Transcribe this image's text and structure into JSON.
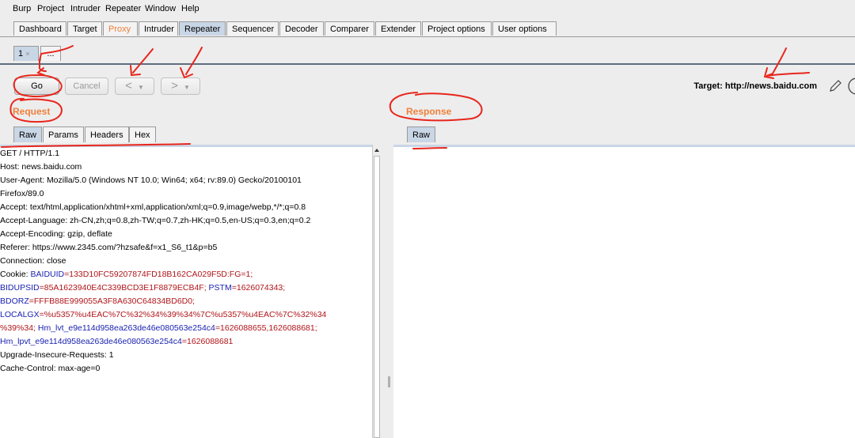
{
  "menu": [
    "Burp",
    "Project",
    "Intruder",
    "Repeater",
    "Window",
    "Help"
  ],
  "tool_tabs": [
    "Dashboard",
    "Target",
    "Proxy",
    "Intruder",
    "Repeater",
    "Sequencer",
    "Decoder",
    "Comparer",
    "Extender",
    "Project options",
    "User options"
  ],
  "repeater_tabs": {
    "tab1": "1",
    "tab1_close": "×",
    "more": "..."
  },
  "toolbar": {
    "go": "Go",
    "cancel": "Cancel",
    "back": "<",
    "back_dd": "▼",
    "forward": ">",
    "forward_dd": "▼"
  },
  "target_label": "Target: http://news.baidu.com",
  "request": {
    "title": "Request",
    "tabs": [
      "Raw",
      "Params",
      "Headers",
      "Hex"
    ],
    "lines": [
      "GET / HTTP/1.1",
      "Host: news.baidu.com",
      "User-Agent: Mozilla/5.0 (Windows NT 10.0; Win64; x64; rv:89.0) Gecko/20100101",
      "Firefox/89.0",
      "Accept: text/html,application/xhtml+xml,application/xml;q=0.9,image/webp,*/*;q=0.8",
      "Accept-Language: zh-CN,zh;q=0.8,zh-TW;q=0.7,zh-HK;q=0.5,en-US;q=0.3,en;q=0.2",
      "Accept-Encoding: gzip, deflate",
      "Referer: https://www.2345.com/?hzsafe&f=x1_S6_t1&p=b5",
      "Connection: close"
    ],
    "cookie": {
      "label": "Cookie: ",
      "l1_k1": "BAIDUID",
      "l1_v1": "=133D10FC59207874FD18B162CA029F5D:FG=1;",
      "l2_k1": "BIDUPSID",
      "l2_v1": "=85A1623940E4C339BCD3E1F8879ECB4F;",
      "l2_k2": " PSTM",
      "l2_v2": "=1626074343;",
      "l3_k1": "BDORZ",
      "l3_v1": "=FFFB88E999055A3F8A630C64834BD6D0;",
      "l4_k1": "LOCALGX",
      "l4_v1": "=%u5357%u4EAC%7C%32%34%39%34%7C%u5357%u4EAC%7C%32%34",
      "l5_v1": "%39%34;",
      "l5_k2": " Hm_lvt_e9e114d958ea263de46e080563e254c4",
      "l5_v2": "=1626088655,1626088681;",
      "l6_k1": "Hm_lpvt_e9e114d958ea263de46e080563e254c4",
      "l6_v1": "=1626088681"
    },
    "tail": [
      "Upgrade-Insecure-Requests: 1",
      "Cache-Control: max-age=0"
    ]
  },
  "response": {
    "title": "Response",
    "tabs": [
      "Raw"
    ]
  },
  "colors": {
    "accent": "#f07f3a",
    "annotation": "#e8261c",
    "active_tab": "#c9d6e6",
    "key_blue": "#1a22b0",
    "value_red": "#b0151a"
  }
}
